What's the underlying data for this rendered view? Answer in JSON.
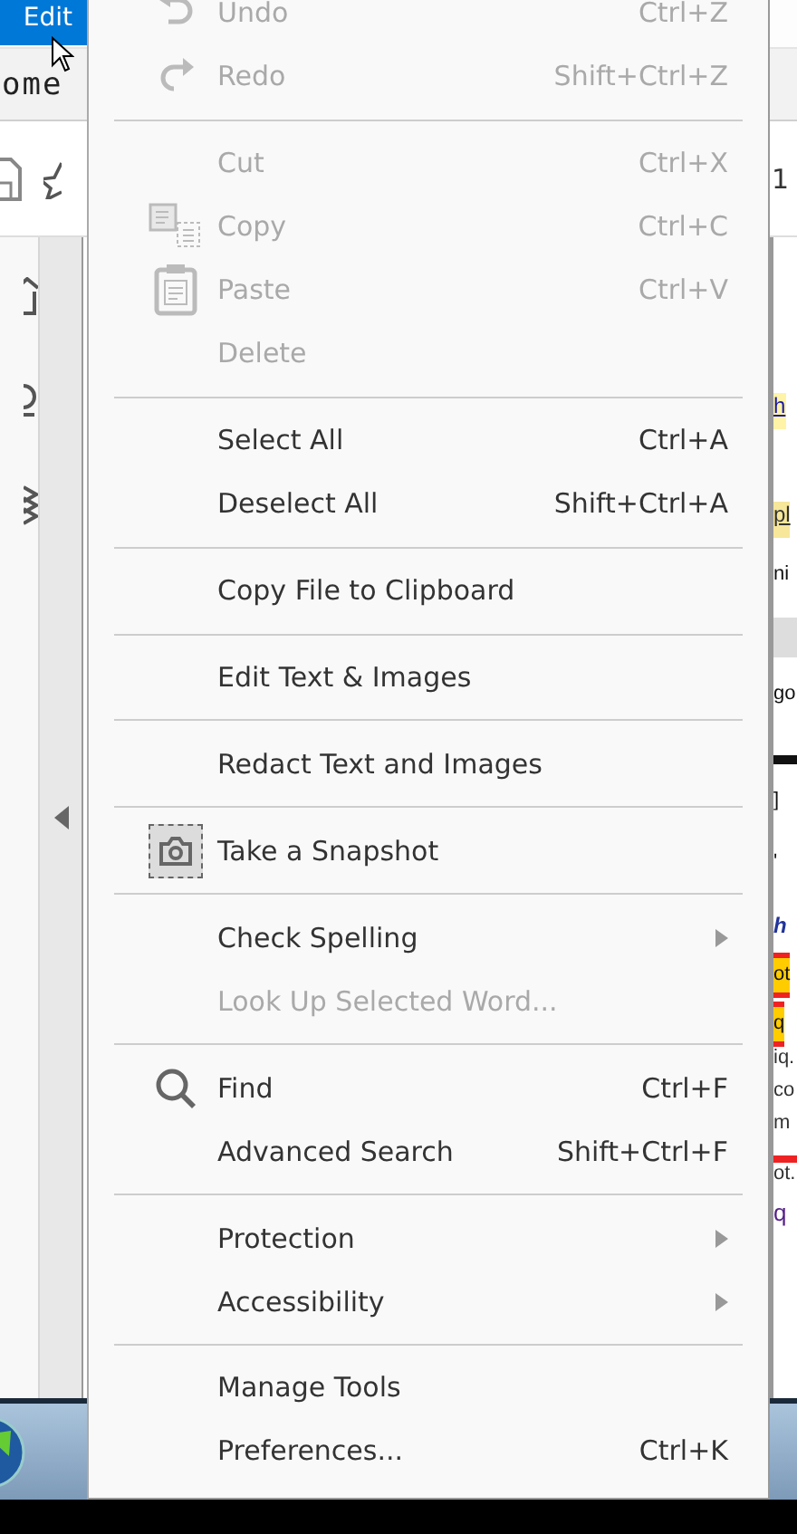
{
  "app_menu_bar": {
    "items": [
      {
        "label": "Edit",
        "selected": true
      }
    ]
  },
  "tab_bar": {
    "tabs": [
      {
        "label": "ome"
      }
    ]
  },
  "page_number": "1",
  "edit_menu": {
    "items": [
      {
        "kind": "item",
        "label": "Undo",
        "shortcut": "Ctrl+Z",
        "disabled": true,
        "submenu": false,
        "checked": false
      },
      {
        "kind": "item",
        "label": "Redo",
        "shortcut": "Shift+Ctrl+Z",
        "disabled": true,
        "submenu": false,
        "checked": false
      },
      {
        "kind": "separator"
      },
      {
        "kind": "item",
        "label": "Cut",
        "shortcut": "Ctrl+X",
        "disabled": true,
        "submenu": false,
        "checked": false
      },
      {
        "kind": "item",
        "label": "Copy",
        "shortcut": "Ctrl+C",
        "disabled": true,
        "submenu": false,
        "checked": false
      },
      {
        "kind": "item",
        "label": "Paste",
        "shortcut": "Ctrl+V",
        "disabled": true,
        "submenu": false,
        "checked": false
      },
      {
        "kind": "item",
        "label": "Delete",
        "disabled": true,
        "submenu": false,
        "checked": false
      },
      {
        "kind": "separator"
      },
      {
        "kind": "item",
        "label": "Select All",
        "shortcut": "Ctrl+A",
        "disabled": false,
        "submenu": false,
        "checked": false
      },
      {
        "kind": "item",
        "label": "Deselect All",
        "shortcut": "Shift+Ctrl+A",
        "disabled": false,
        "submenu": false,
        "checked": false
      },
      {
        "kind": "separator"
      },
      {
        "kind": "item",
        "label": "Copy File to Clipboard",
        "disabled": false,
        "submenu": false,
        "checked": false
      },
      {
        "kind": "separator"
      },
      {
        "kind": "item",
        "label": "Edit Text & Images",
        "disabled": false,
        "submenu": false,
        "checked": false
      },
      {
        "kind": "separator"
      },
      {
        "kind": "item",
        "label": "Redact Text and Images",
        "disabled": false,
        "submenu": false,
        "checked": false
      },
      {
        "kind": "separator"
      },
      {
        "kind": "item",
        "label": "Take a Snapshot",
        "disabled": false,
        "submenu": false,
        "checked": true
      },
      {
        "kind": "separator"
      },
      {
        "kind": "item",
        "label": "Check Spelling",
        "disabled": false,
        "submenu": true,
        "checked": false
      },
      {
        "kind": "item",
        "label": "Look Up Selected Word...",
        "disabled": true,
        "submenu": false,
        "checked": false
      },
      {
        "kind": "separator"
      },
      {
        "kind": "item",
        "label": "Find",
        "shortcut": "Ctrl+F",
        "disabled": false,
        "submenu": false,
        "checked": false
      },
      {
        "kind": "item",
        "label": "Advanced Search",
        "shortcut": "Shift+Ctrl+F",
        "disabled": false,
        "submenu": false,
        "checked": false
      },
      {
        "kind": "separator"
      },
      {
        "kind": "item",
        "label": "Protection",
        "disabled": false,
        "submenu": true,
        "checked": false
      },
      {
        "kind": "item",
        "label": "Accessibility",
        "disabled": false,
        "submenu": true,
        "checked": false
      },
      {
        "kind": "separator"
      },
      {
        "kind": "item",
        "label": "Manage Tools",
        "disabled": false,
        "submenu": false,
        "checked": false
      },
      {
        "kind": "item",
        "label": "Preferences...",
        "shortcut": "Ctrl+K",
        "disabled": false,
        "submenu": false,
        "checked": false
      }
    ]
  },
  "document_snippets": [
    {
      "kind": "gap"
    },
    {
      "kind": "link-highlight",
      "text": "h"
    },
    {
      "kind": "highlight",
      "text": "pl"
    },
    {
      "kind": "text",
      "text": "ni"
    },
    {
      "kind": "band"
    },
    {
      "kind": "text",
      "text": "go"
    },
    {
      "kind": "thick-rule"
    },
    {
      "kind": "text",
      "text": "]"
    },
    {
      "kind": "text",
      "text": "'"
    },
    {
      "kind": "italic-link",
      "text": "h"
    },
    {
      "kind": "boxed-highlight",
      "text": "ot"
    },
    {
      "kind": "boxed-highlight",
      "text": "q"
    },
    {
      "kind": "small",
      "text": "iq."
    },
    {
      "kind": "small",
      "text": "co"
    },
    {
      "kind": "small",
      "text": "m"
    },
    {
      "kind": "red-rule"
    },
    {
      "kind": "small",
      "text": "ot."
    },
    {
      "kind": "purple",
      "text": "q"
    }
  ]
}
